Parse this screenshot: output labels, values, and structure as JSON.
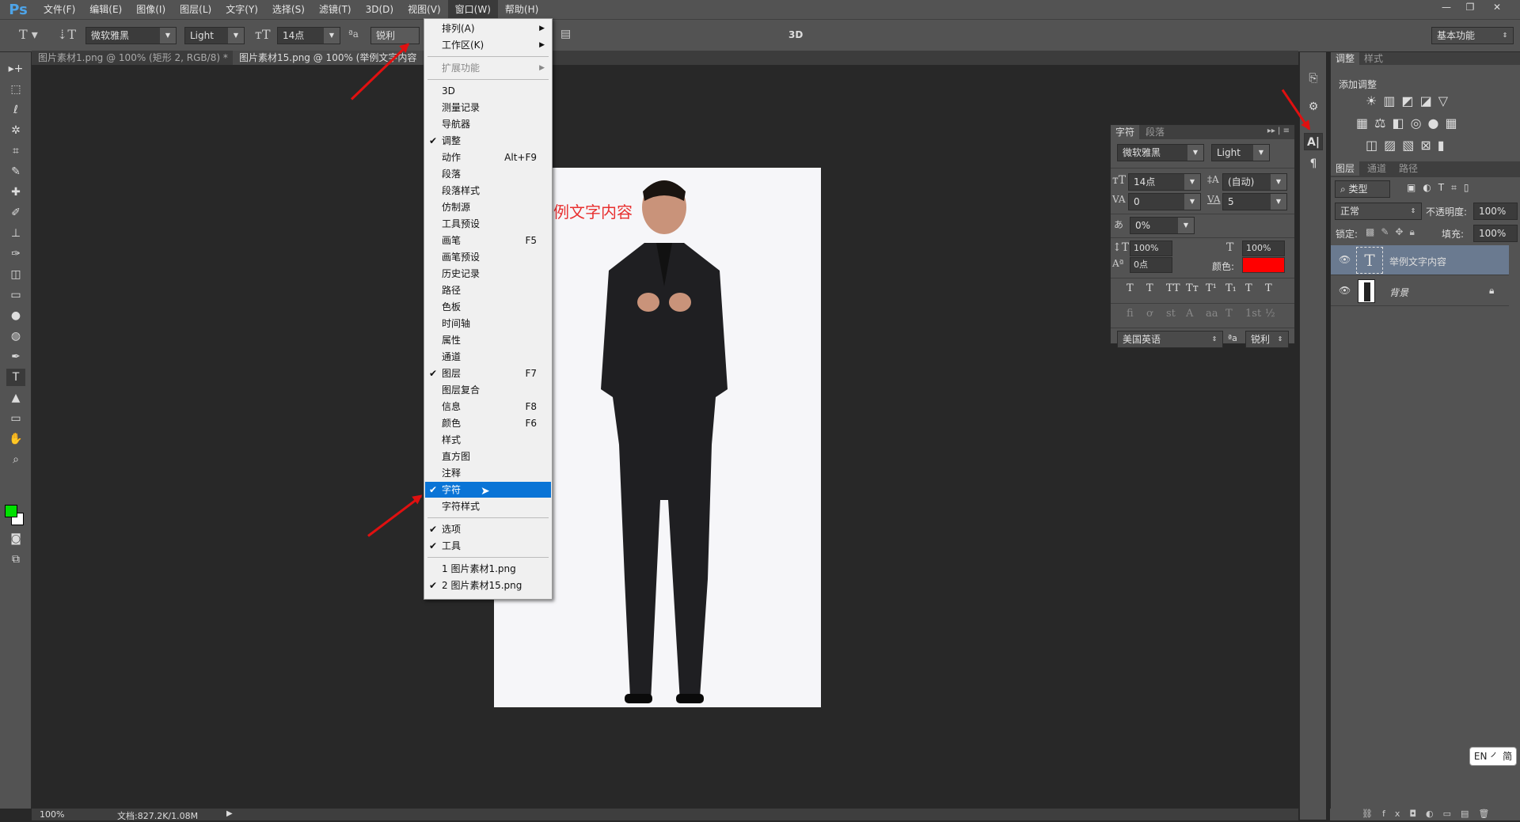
{
  "app": {
    "logo": "Ps",
    "menu": [
      "文件(F)",
      "编辑(E)",
      "图像(I)",
      "图层(L)",
      "文字(Y)",
      "选择(S)",
      "滤镜(T)",
      "3D(D)",
      "视图(V)",
      "窗口(W)",
      "帮助(H)"
    ],
    "active_menu": "窗口(W)"
  },
  "window_controls": {
    "minimize": "—",
    "restore": "❐",
    "close": "✕"
  },
  "options": {
    "font_family": "微软雅黑",
    "font_style": "Light",
    "font_size": "14点",
    "antialias": "锐利",
    "mode_3d": "3D",
    "workspace": "基本功能"
  },
  "tabs": [
    {
      "label": "图片素材1.png @ 100% (矩形 2, RGB/8) *",
      "close": "×"
    },
    {
      "label": "图片素材15.png @ 100% (举例文字内容"
    }
  ],
  "document": {
    "text": "举例文字内容"
  },
  "window_menu": {
    "groups": [
      [
        {
          "label": "排列(A)",
          "submenu": true
        },
        {
          "label": "工作区(K)",
          "submenu": true
        }
      ],
      [
        {
          "label": "扩展功能",
          "submenu": true,
          "disabled": true
        }
      ],
      [
        {
          "label": "3D"
        },
        {
          "label": "测量记录"
        },
        {
          "label": "导航器"
        },
        {
          "label": "调整",
          "checked": true
        },
        {
          "label": "动作",
          "shortcut": "Alt+F9"
        },
        {
          "label": "段落"
        },
        {
          "label": "段落样式"
        },
        {
          "label": "仿制源"
        },
        {
          "label": "工具预设"
        },
        {
          "label": "画笔",
          "shortcut": "F5"
        },
        {
          "label": "画笔预设"
        },
        {
          "label": "历史记录"
        },
        {
          "label": "路径"
        },
        {
          "label": "色板"
        },
        {
          "label": "时间轴"
        },
        {
          "label": "属性"
        },
        {
          "label": "通道"
        },
        {
          "label": "图层",
          "checked": true,
          "shortcut": "F7"
        },
        {
          "label": "图层复合"
        },
        {
          "label": "信息",
          "shortcut": "F8"
        },
        {
          "label": "颜色",
          "shortcut": "F6"
        },
        {
          "label": "样式"
        },
        {
          "label": "直方图"
        },
        {
          "label": "注释"
        },
        {
          "label": "字符",
          "checked": true,
          "highlighted": true
        },
        {
          "label": "字符样式"
        }
      ],
      [
        {
          "label": "选项",
          "checked": true
        },
        {
          "label": "工具",
          "checked": true
        }
      ],
      [
        {
          "label": "1 图片素材1.png"
        },
        {
          "label": "2 图片素材15.png",
          "checked": true
        }
      ]
    ]
  },
  "character_panel": {
    "tabs": [
      "字符",
      "段落"
    ],
    "font_family": "微软雅黑",
    "font_style": "Light",
    "size": "14点",
    "leading": "(自动)",
    "kerning": "0",
    "tracking": "5",
    "tsume": "0%",
    "vscale": "100%",
    "hscale": "100%",
    "baseline": "0点",
    "color_label": "颜色:",
    "color": "#ff0000",
    "style_buttons": [
      "T",
      "T",
      "TT",
      "Tт",
      "T¹",
      "T₁",
      "T",
      "T"
    ],
    "opentype_buttons": [
      "ﬁ",
      "ơ",
      "st",
      "A",
      "aa",
      "T",
      "1st",
      "½"
    ],
    "language": "美国英语",
    "aa_label": "ªa",
    "antialias": "锐利"
  },
  "adjust_panel": {
    "tabs": [
      "调整",
      "样式"
    ],
    "title": "添加调整"
  },
  "layers_panel": {
    "tabs": [
      "图层",
      "通道",
      "路径"
    ],
    "filter": "类型",
    "blend": "正常",
    "opacity_label": "不透明度:",
    "opacity": "100%",
    "lock_label": "锁定:",
    "fill_label": "填充:",
    "fill": "100%",
    "layers": [
      {
        "name": "举例文字内容",
        "type": "text",
        "selected": true
      },
      {
        "name": "背景",
        "type": "image",
        "locked": true
      }
    ]
  },
  "status": {
    "zoom": "100%",
    "doc": "文档:827.2K/1.08M"
  },
  "ime": {
    "label": "EN ㇒ 简"
  },
  "colors": {
    "foreground": "#00e000",
    "background": "#ffffff",
    "accent": "#0a74d6",
    "arrow": "#e01010"
  }
}
